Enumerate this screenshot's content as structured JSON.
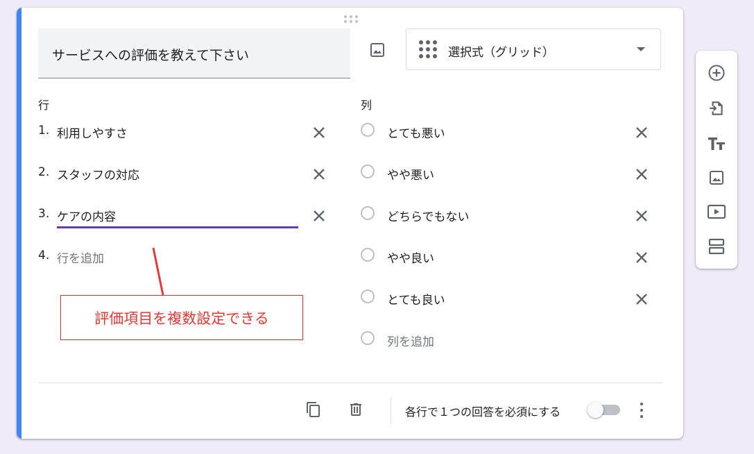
{
  "question": {
    "title": "サービスへの評価を教えて下さい",
    "type_label": "選択式（グリッド）"
  },
  "rows": {
    "label": "行",
    "items": [
      {
        "num": "1.",
        "text": "利用しやすさ"
      },
      {
        "num": "2.",
        "text": "スタッフの対応"
      },
      {
        "num": "3.",
        "text": "ケアの内容"
      }
    ],
    "add": {
      "num": "4.",
      "text": "行を追加"
    }
  },
  "columns": {
    "label": "列",
    "items": [
      {
        "text": "とても悪い"
      },
      {
        "text": "やや悪い"
      },
      {
        "text": "どちらでもない"
      },
      {
        "text": "やや良い"
      },
      {
        "text": "とても良い"
      }
    ],
    "add": {
      "text": "列を追加"
    }
  },
  "annotation": {
    "text": "評価項目を複数設定できる",
    "color": "#e53935"
  },
  "footer": {
    "required_label": "各行で１つの回答を必須にする",
    "required_on": false
  },
  "icons": {
    "image": "image-icon",
    "grid": "grid-icon",
    "close": "close-icon",
    "copy": "copy-icon",
    "delete": "trash-icon",
    "more": "more-vert-icon",
    "toolbar": [
      "add-circle-icon",
      "import-icon",
      "title-icon",
      "image-icon",
      "video-icon",
      "section-icon"
    ]
  },
  "colors": {
    "accent": "#4285f4",
    "focus": "#673ab7",
    "background": "#efebf8"
  }
}
